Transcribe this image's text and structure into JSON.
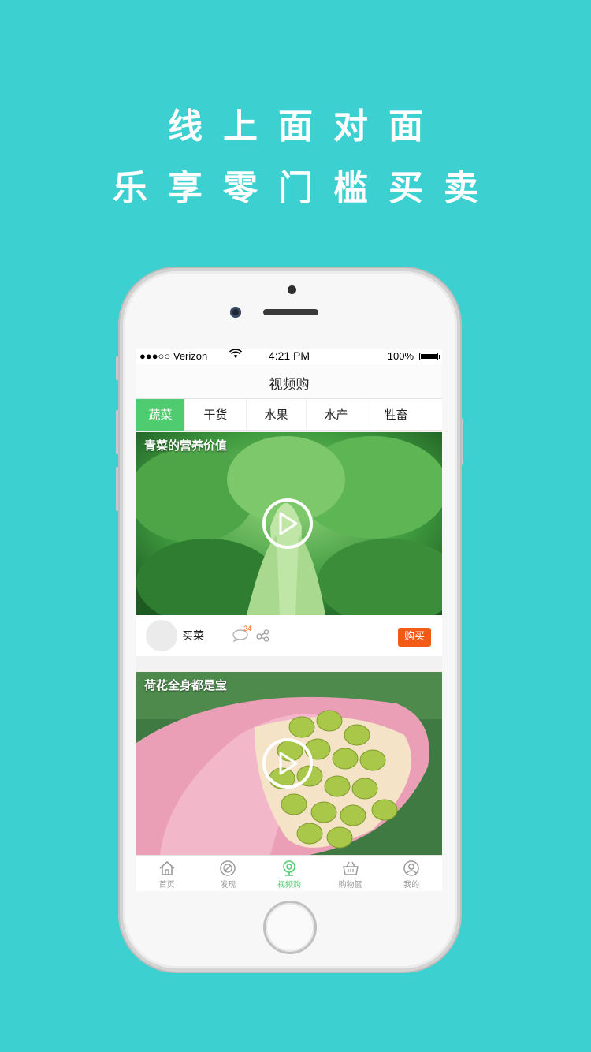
{
  "promo": {
    "line1": "线上面对面",
    "line2": "乐享零门槛买卖"
  },
  "status_bar": {
    "carrier": "●●●○○ Verizon",
    "time": "4:21 PM",
    "battery": "100%",
    "battery_level": 1.0
  },
  "navbar": {
    "title": "视频购"
  },
  "tabs": [
    {
      "label": "蔬菜",
      "active": true
    },
    {
      "label": "干货",
      "active": false
    },
    {
      "label": "水果",
      "active": false
    },
    {
      "label": "水产",
      "active": false
    },
    {
      "label": "牲畜",
      "active": false
    }
  ],
  "feed": [
    {
      "title": "青菜的营养价值",
      "seller": "买菜",
      "comments": "24",
      "buy_label": "购买"
    },
    {
      "title": "荷花全身都是宝"
    }
  ],
  "tabbar": [
    {
      "label": "首页",
      "icon": "home-icon"
    },
    {
      "label": "发现",
      "icon": "compass-icon"
    },
    {
      "label": "视频购",
      "icon": "webcam-icon",
      "active": true
    },
    {
      "label": "购物篮",
      "icon": "basket-icon"
    },
    {
      "label": "我的",
      "icon": "user-icon"
    }
  ],
  "colors": {
    "background": "#3cd0d0",
    "accent_green": "#4fcc70",
    "buy_orange": "#f25a16"
  }
}
